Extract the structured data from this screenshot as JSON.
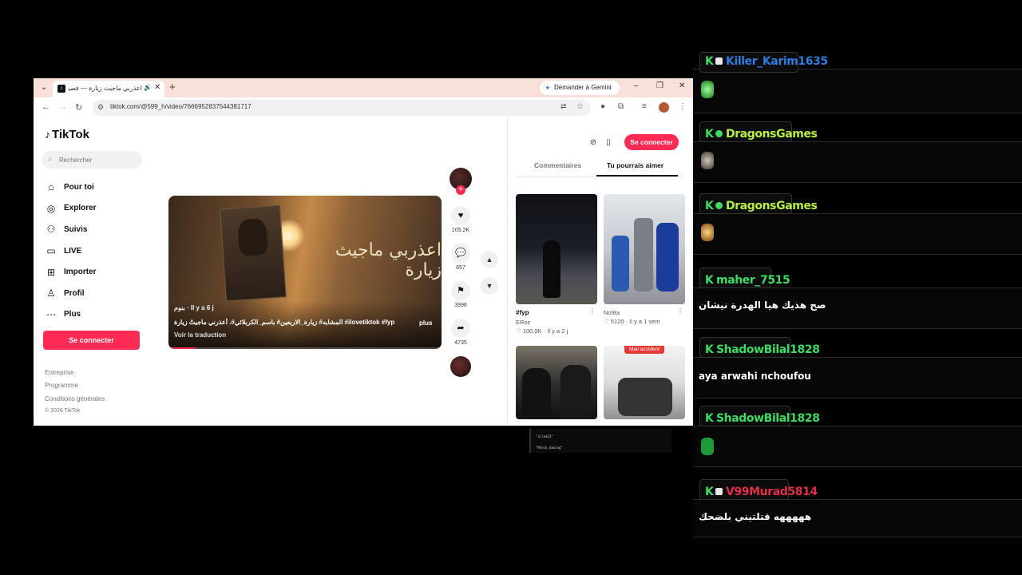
{
  "browser": {
    "tab_title": "اعذربي ماجيث زيارة — فصيد:",
    "new_tab_symbol": "+",
    "gemini_label": "Demander à Gemini",
    "url": "tiktok.com/@599_h/video/7666952837544381717",
    "window_controls": {
      "minimize": "–",
      "restore": "❐",
      "close": "✕"
    }
  },
  "tiktok": {
    "logo": "TikTok",
    "search_placeholder": "Rechercher",
    "nav": [
      {
        "label": "Pour toi",
        "icon": "home-icon"
      },
      {
        "label": "Explorer",
        "icon": "compass-icon"
      },
      {
        "label": "Suivis",
        "icon": "following-icon"
      },
      {
        "label": "LIVE",
        "icon": "live-icon"
      },
      {
        "label": "Importer",
        "icon": "upload-icon"
      },
      {
        "label": "Profil",
        "icon": "profile-icon"
      },
      {
        "label": "Plus",
        "icon": "more-icon"
      }
    ],
    "login_label": "Se connecter",
    "footer": [
      "Entreprise",
      "Programme",
      "Conditions générales",
      "© 2026 TikTok"
    ],
    "video": {
      "overlay_title": "اعذربي ماجيث زيارة",
      "author_line": "بنوم · Il y a 6 j",
      "caption": "المشايه# زيارة_الاربعين# باسم_الكربلائي#. أعذرني ماجيتْ زيارة #ilovetiktok #fyp",
      "more_label": "plus",
      "translate_label": "Voir la traduction",
      "progress": 0.1
    },
    "actions": {
      "likes": "105.2K",
      "comments": "657",
      "saves": "3996",
      "shares": "4735"
    },
    "right_panel": {
      "tabs": [
        "Commentaires",
        "Tu pourrais aimer"
      ],
      "active_tab": "Tu pourrais aimer",
      "login_label": "Se connecter",
      "cards": [
        {
          "title": "#fyp",
          "author": "ERoz",
          "likes": "100.9K",
          "time": "Il y a 2 j"
        },
        {
          "title": "",
          "author": "No9ta",
          "likes": "5120",
          "time": "Il y a 1 sem"
        },
        {
          "badge": ""
        },
        {
          "badge": "Mail accident"
        }
      ]
    }
  },
  "chat": [
    {
      "username": "Killer_Karim1635",
      "color": "#2f7de0",
      "message": "",
      "emote": true,
      "sub_badge_color": "#e8e8e8"
    },
    {
      "username": "DragonsGames",
      "color": "#b8f040",
      "message": "",
      "emote": true,
      "sub_badge_color": "#3cdc64"
    },
    {
      "username": "DragonsGames",
      "color": "#b8f040",
      "message": "",
      "emote": true,
      "sub_badge_color": "#3cdc64"
    },
    {
      "username": "maher_7515",
      "color": "#3cdc64",
      "message": "صح هذيك هيا الهدرة نيشان",
      "emote": false
    },
    {
      "username": "ShadowBilal1828",
      "color": "#3cdc64",
      "message": "aya arwahi nchoufou",
      "emote": false
    },
    {
      "username": "ShadowBilal1828",
      "color": "#3cdc64",
      "message": "",
      "emote": true
    },
    {
      "username": "V99Murad5814",
      "color": "#e0304a",
      "message": "هههههه قتلتيني بلضحك",
      "emote": false,
      "sub_badge_color": "#e8e8e8"
    }
  ],
  "mini_terminal": [
    "\"allem23\"",
    "\"Mohib_Gaming\""
  ]
}
